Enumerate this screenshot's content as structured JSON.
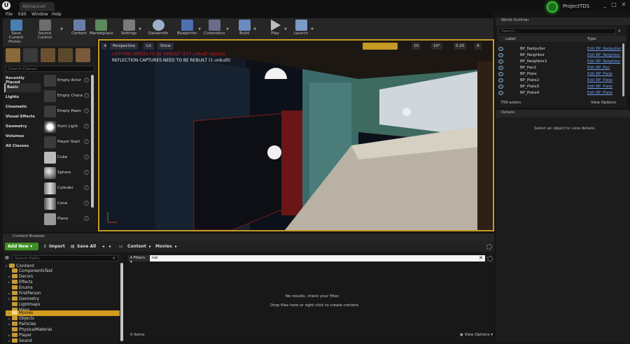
{
  "window": {
    "tab": "AlphaLevel",
    "project": "ProjectTDS",
    "controls": [
      "_",
      "□",
      "✕"
    ]
  },
  "menu": [
    "File",
    "Edit",
    "Window",
    "Help"
  ],
  "toolbar": [
    {
      "label": "Save Current",
      "icon": "save-icon",
      "color": "#4a7fb5"
    },
    {
      "label": "Source Control",
      "icon": "source-control-icon",
      "color": "#6d6d6d"
    },
    {
      "label": "Content",
      "icon": "content-icon",
      "color": "#6a7fa8"
    },
    {
      "label": "Marketplace",
      "icon": "marketplace-icon",
      "color": "#5c8a5c"
    },
    {
      "label": "Settings",
      "icon": "settings-icon",
      "color": "#7a7a7a"
    },
    {
      "label": "Datasmith",
      "icon": "datasmith-icon",
      "color": "#9eaec8"
    },
    {
      "label": "Blueprints",
      "icon": "blueprints-icon",
      "color": "#4f6fb0"
    },
    {
      "label": "Cinematics",
      "icon": "cinematics-icon",
      "color": "#6b6b8b"
    },
    {
      "label": "Build",
      "icon": "build-icon",
      "color": "#6a8ac0"
    },
    {
      "label": "Play",
      "icon": "play-icon",
      "color": "#bcbcbc"
    },
    {
      "label": "Launch",
      "icon": "launch-icon",
      "color": "#7a9ac8"
    }
  ],
  "modes": {
    "title": "Modes",
    "search_placeholder": "Search Classes",
    "categories": [
      "Recently Placed",
      "Basic",
      "Lights",
      "Cinematic",
      "Visual Effects",
      "Geometry",
      "Volumes",
      "All Classes"
    ],
    "selected_category": "Basic",
    "items": [
      "Empty Actor",
      "Empty Chara",
      "Empty Pawn",
      "Point Light",
      "Player Start",
      "Cube",
      "Sphere",
      "Cylinder",
      "Cone",
      "Plane"
    ]
  },
  "viewport": {
    "perspective": "Perspective",
    "lit": "Lit",
    "show": "Show",
    "grid_snap": "10",
    "rot_snap": "10°",
    "scale_snap": "0.25",
    "camera_speed": "4",
    "warning_lighting": "LIGHTING NEEDS TO BE REBUILT (237 unbuilt objects)",
    "warning_reflection": "REFLECTION CAPTURES NEED TO BE REBUILT (1 unbuilt)"
  },
  "outliner": {
    "title": "World Outliner",
    "search_placeholder": "Search...",
    "col_label": "Label",
    "col_type": "Type",
    "rows": [
      {
        "label": "BP_Nailpuller",
        "type": "Edit BP_Nailpuller"
      },
      {
        "label": "BP_Neighbor",
        "type": "Edit BP_Neighbor"
      },
      {
        "label": "BP_Neighbor2",
        "type": "Edit BP_Neighbor"
      },
      {
        "label": "BP_Pan2",
        "type": "Edit BP_Pan"
      },
      {
        "label": "BP_Plate",
        "type": "Edit BP_Plate"
      },
      {
        "label": "BP_Plate2",
        "type": "Edit BP_Plate"
      },
      {
        "label": "BP_Plate3",
        "type": "Edit BP_Plate"
      },
      {
        "label": "BP_Plate4",
        "type": "Edit BP_Plate"
      }
    ],
    "actor_count": "759 actors",
    "view_options": "View Options"
  },
  "details": {
    "title": "Details",
    "message": "Select an object to view details."
  },
  "content_browser": {
    "title": "Content Browser",
    "add_new": "Add New",
    "import": "Import",
    "save_all": "Save All",
    "breadcrumb": [
      "Content",
      "Movies"
    ],
    "paths_placeholder": "Search Paths",
    "root": "Content",
    "folders": [
      "ComponentsTest",
      "Decors",
      "Effects",
      "Enums",
      "FirstPerson",
      "Geometry",
      "Lightmaps",
      "Maps",
      "Movies",
      "Objects",
      "Particles",
      "PhysicalMaterial",
      "Player",
      "Sound"
    ],
    "selected_folder": "Movies",
    "filters": "Filters",
    "search_value": "nei",
    "no_results": "No results, check your filter.",
    "drop_hint": "Drop files here or right click to create content.",
    "item_count": "0 items",
    "view_options": "View Options"
  }
}
